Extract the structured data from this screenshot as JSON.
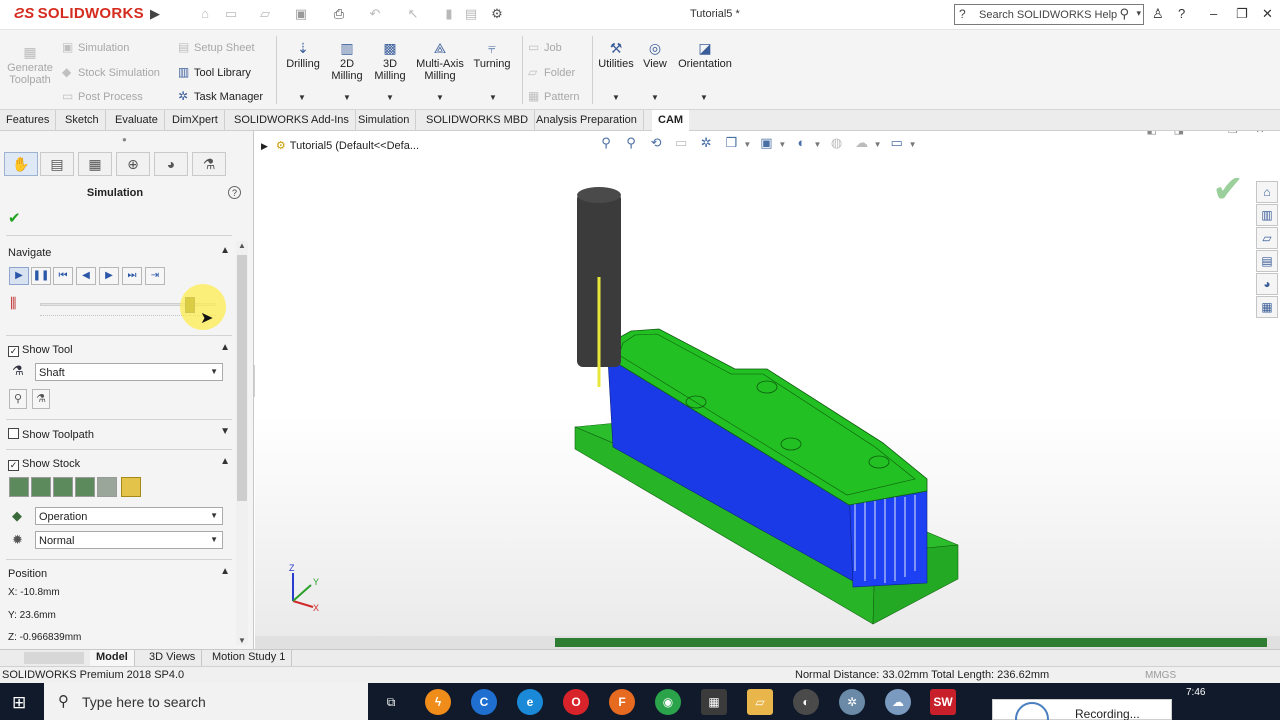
{
  "app": {
    "brand": "SOLIDWORKS",
    "document_title": "Tutorial5 *",
    "search_placeholder": "Search SOLIDWORKS Help"
  },
  "ribbon": {
    "left_group": {
      "generate_toolpath": "Generate Toolpath",
      "simulation": "Simulation",
      "stock_simulation": "Stock Simulation",
      "post_process": "Post Process",
      "setup_sheet": "Setup Sheet",
      "tool_library": "Tool Library",
      "task_manager": "Task Manager"
    },
    "milling": {
      "drilling": "Drilling",
      "milling_2d_line1": "2D",
      "milling_2d_line2": "Milling",
      "milling_3d_line1": "3D",
      "milling_3d_line2": "Milling",
      "multi_axis_line1": "Multi-Axis",
      "multi_axis_line2": "Milling",
      "turning": "Turning"
    },
    "right_group": {
      "job": "Job",
      "folder": "Folder",
      "pattern": "Pattern",
      "utilities": "Utilities",
      "view": "View",
      "orientation": "Orientation"
    }
  },
  "command_tabs": [
    "Features",
    "Sketch",
    "Evaluate",
    "DimXpert",
    "SOLIDWORKS Add-Ins",
    "Simulation",
    "SOLIDWORKS MBD",
    "Analysis Preparation",
    "CAM"
  ],
  "active_command_tab": "CAM",
  "property_manager": {
    "title": "Simulation",
    "navigate": {
      "label": "Navigate",
      "slider_position": 0.85
    },
    "show_tool": {
      "label": "Show Tool",
      "checked": true,
      "mode": "Shaft"
    },
    "show_toolpath": {
      "label": "Show Toolpath",
      "checked": false
    },
    "show_stock": {
      "label": "Show Stock",
      "checked": true,
      "option1": "Operation",
      "option2": "Normal"
    },
    "position": {
      "label": "Position",
      "x": "X: -10.8mm",
      "y": "Y: 23.6mm",
      "z": "Z: -0.966839mm"
    }
  },
  "viewport": {
    "tree_node": "Tutorial5  (Default<<Defa...",
    "axes": {
      "x": "X",
      "y": "Y",
      "z": "Z"
    },
    "colors": {
      "stock_top": "#22c022",
      "stock_side": "#1a3cf0",
      "base_plate": "#27b827",
      "tool_holder": "#3a3a3a",
      "tool_path": "#e5e53a"
    }
  },
  "bottom_tabs": [
    "Model",
    "3D Views",
    "Motion Study 1"
  ],
  "active_bottom_tab": "Model",
  "status": {
    "version": "SOLIDWORKS Premium 2018 SP4.0",
    "measure": "Normal Distance: 33.02mm Total Length: 236.62mm",
    "units": "MMGS"
  },
  "taskbar": {
    "search_placeholder": "Type here to search",
    "time": "7:46",
    "recording": "Recording..."
  }
}
